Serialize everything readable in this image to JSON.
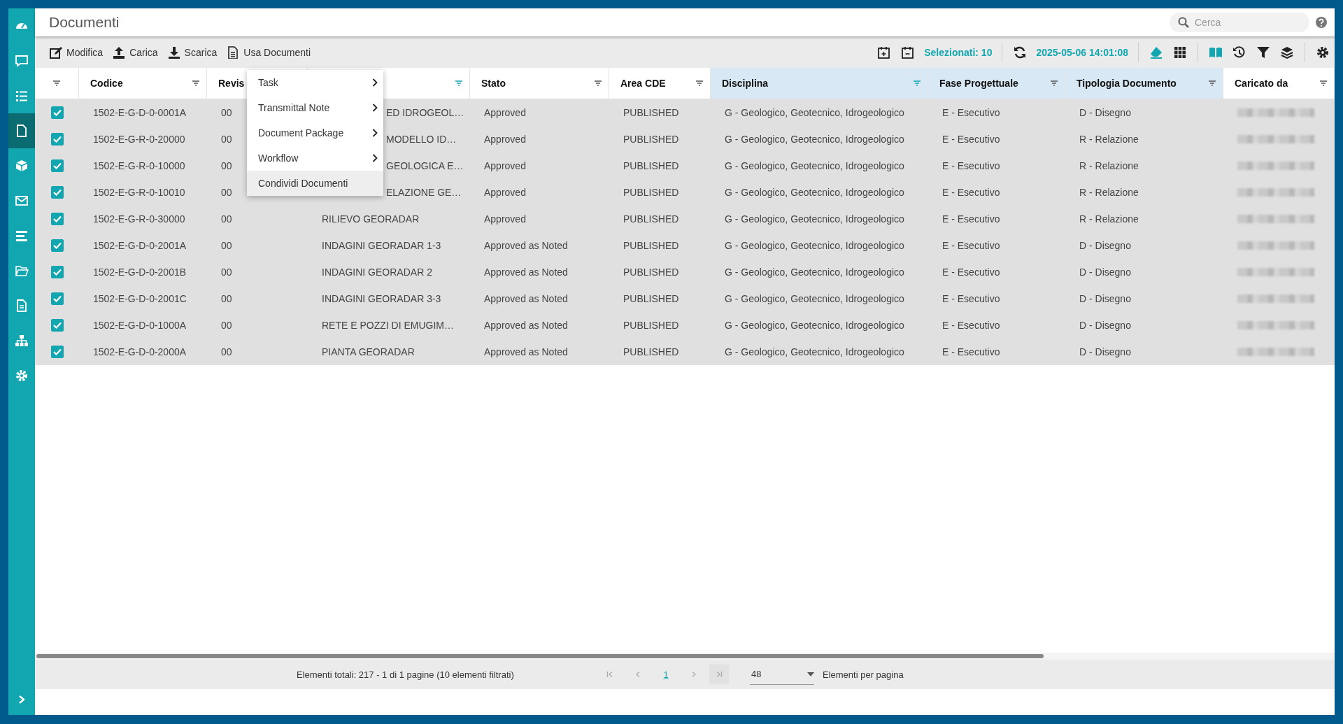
{
  "header": {
    "title": "Documenti",
    "search": {
      "placeholder": "Cerca"
    }
  },
  "sidebar": {
    "items": [
      {
        "kind": "dashboard",
        "selected": false
      },
      {
        "kind": "chat",
        "selected": false
      },
      {
        "kind": "list",
        "selected": false
      },
      {
        "kind": "document",
        "selected": true
      },
      {
        "kind": "cube",
        "selected": false
      },
      {
        "kind": "mail",
        "selected": false
      },
      {
        "kind": "bars",
        "selected": false
      },
      {
        "kind": "folder",
        "selected": false
      },
      {
        "kind": "page",
        "selected": false
      },
      {
        "kind": "sitemap",
        "selected": false
      },
      {
        "kind": "gear",
        "selected": false
      }
    ]
  },
  "toolbar": {
    "actions": [
      {
        "kind": "edit",
        "label": "Modifica"
      },
      {
        "kind": "upload",
        "label": "Carica"
      },
      {
        "kind": "download",
        "label": "Scarica"
      },
      {
        "kind": "file",
        "label": "Usa Documenti"
      }
    ],
    "selected_count": "Selezionati: 10",
    "timestamp": "2025-05-06 14:01:08"
  },
  "table": {
    "columns": [
      {
        "filtered": false,
        "highlighted": false
      },
      {
        "label": "Codice",
        "filtered": false,
        "highlighted": false
      },
      {
        "label": "Revis",
        "highlighted": false
      },
      {
        "filtered": true,
        "highlighted": false
      },
      {
        "label": "Stato",
        "filtered": false,
        "highlighted": false
      },
      {
        "label": "Area CDE",
        "filtered": false,
        "highlighted": false
      },
      {
        "label": "Disciplina",
        "filtered": true,
        "highlighted": true
      },
      {
        "label": "Fase Progettuale",
        "filtered": false,
        "highlighted": true
      },
      {
        "label": "Tipologia Documento",
        "filtered": false,
        "highlighted": true
      },
      {
        "label": "Caricato da",
        "filtered": false,
        "highlighted": false
      }
    ],
    "rows": [
      {
        "checked": true,
        "codice": "1502-E-G-D-0-0001A",
        "revisione": "00",
        "titolo": "ED IDROGEOL…",
        "stato": "Approved",
        "area_cde": "PUBLISHED",
        "disciplina": "G - Geologico, Geotecnico, Idrogeologico",
        "fase": "E - Esecutivo",
        "tipologia": "D - Disegno"
      },
      {
        "checked": true,
        "codice": "1502-E-G-R-0-20000",
        "revisione": "00",
        "titolo": "MODELLO ID…",
        "stato": "Approved",
        "area_cde": "PUBLISHED",
        "disciplina": "G - Geologico, Geotecnico, Idrogeologico",
        "fase": "E - Esecutivo",
        "tipologia": "R - Relazione"
      },
      {
        "checked": true,
        "codice": "1502-E-G-R-0-10000",
        "revisione": "00",
        "titolo": "GEOLOGICA E…",
        "stato": "Approved",
        "area_cde": "PUBLISHED",
        "disciplina": "G - Geologico, Geotecnico, Idrogeologico",
        "fase": "E - Esecutivo",
        "tipologia": "R - Relazione"
      },
      {
        "checked": true,
        "codice": "1502-E-G-R-0-10010",
        "revisione": "00",
        "titolo": "ELAZIONE GE…",
        "stato": "Approved",
        "area_cde": "PUBLISHED",
        "disciplina": "G - Geologico, Geotecnico, Idrogeologico",
        "fase": "E - Esecutivo",
        "tipologia": "R - Relazione"
      },
      {
        "checked": true,
        "codice": "1502-E-G-R-0-30000",
        "revisione": "00",
        "titolo": "RILIEVO GEORADAR",
        "stato": "Approved",
        "area_cde": "PUBLISHED",
        "disciplina": "G - Geologico, Geotecnico, Idrogeologico",
        "fase": "E - Esecutivo",
        "tipologia": "R - Relazione"
      },
      {
        "checked": true,
        "codice": "1502-E-G-D-0-2001A",
        "revisione": "00",
        "titolo": "INDAGINI GEORADAR 1-3",
        "stato": "Approved as Noted",
        "area_cde": "PUBLISHED",
        "disciplina": "G - Geologico, Geotecnico, Idrogeologico",
        "fase": "E - Esecutivo",
        "tipologia": "D - Disegno"
      },
      {
        "checked": true,
        "codice": "1502-E-G-D-0-2001B",
        "revisione": "00",
        "titolo": "INDAGINI GEORADAR 2",
        "stato": "Approved as Noted",
        "area_cde": "PUBLISHED",
        "disciplina": "G - Geologico, Geotecnico, Idrogeologico",
        "fase": "E - Esecutivo",
        "tipologia": "D - Disegno"
      },
      {
        "checked": true,
        "codice": "1502-E-G-D-0-2001C",
        "revisione": "00",
        "titolo": "INDAGINI GEORADAR 3-3",
        "stato": "Approved as Noted",
        "area_cde": "PUBLISHED",
        "disciplina": "G - Geologico, Geotecnico, Idrogeologico",
        "fase": "E - Esecutivo",
        "tipologia": "D - Disegno"
      },
      {
        "checked": true,
        "codice": "1502-E-G-D-0-1000A",
        "revisione": "00",
        "titolo": "RETE E POZZI DI EMUGIM…",
        "stato": "Approved as Noted",
        "area_cde": "PUBLISHED",
        "disciplina": "G - Geologico, Geotecnico, Idrogeologico",
        "fase": "E - Esecutivo",
        "tipologia": "D - Disegno"
      },
      {
        "checked": true,
        "codice": "1502-E-G-D-0-2000A",
        "revisione": "00",
        "titolo": "PIANTA GEORADAR",
        "stato": "Approved as Noted",
        "area_cde": "PUBLISHED",
        "disciplina": "G - Geologico, Geotecnico, Idrogeologico",
        "fase": "E - Esecutivo",
        "tipologia": "D - Disegno"
      }
    ]
  },
  "context_menu": {
    "items": [
      {
        "kind": "submenu",
        "label": "Task",
        "highlighted": false
      },
      {
        "kind": "submenu",
        "label": "Transmittal Note",
        "highlighted": false
      },
      {
        "kind": "submenu",
        "label": "Document Package",
        "highlighted": false
      },
      {
        "kind": "submenu",
        "label": "Workflow",
        "highlighted": false
      },
      {
        "kind": "action",
        "label": "Condividi Documenti",
        "highlighted": true
      }
    ]
  },
  "footer": {
    "summary": "Elementi totali: 217 - 1 di 1 pagine (10 elementi filtrati)",
    "pages": [
      {
        "label": "1",
        "selected": true
      }
    ],
    "page_size": "48",
    "page_size_label": "Elementi per pagina"
  }
}
